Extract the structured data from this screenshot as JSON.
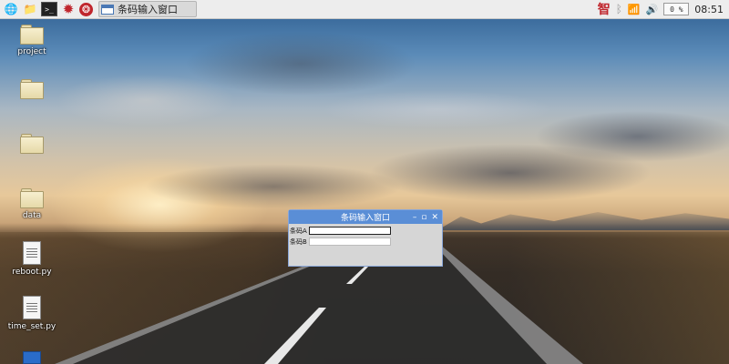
{
  "taskbar": {
    "launchers": [
      {
        "name": "globe-icon",
        "glyph": "🌐"
      },
      {
        "name": "folder-icon",
        "glyph": "📁"
      },
      {
        "name": "terminal-icon",
        "glyph": ">_"
      },
      {
        "name": "star-burst-icon",
        "glyph": "✹"
      },
      {
        "name": "wolfram-icon",
        "glyph": "❂"
      }
    ],
    "task": {
      "label": "条码输入窗口"
    },
    "tray": {
      "ime": "智",
      "bluetooth_glyph": "ᛒ",
      "wifi_glyph": "📶",
      "volume_glyph": "🔊",
      "cpu": "0 %",
      "clock": "08:51"
    }
  },
  "desktop": {
    "icons": [
      {
        "label": "project",
        "kind": "folder"
      },
      {
        "label": "",
        "kind": "folder"
      },
      {
        "label": "",
        "kind": "folder"
      },
      {
        "label": "data",
        "kind": "folder"
      },
      {
        "label": "reboot.py",
        "kind": "file"
      },
      {
        "label": "time_set.py",
        "kind": "file"
      }
    ]
  },
  "dialog": {
    "title": "条码输入窗口",
    "controls": {
      "minimize": "–",
      "maximize": "▫",
      "close": "✕"
    },
    "fields": [
      {
        "label": "条码A",
        "value": ""
      },
      {
        "label": "条码B",
        "value": ""
      }
    ]
  },
  "colors": {
    "taskbar_bg": "#ededed",
    "dialog_title_bg": "#5a8ed6",
    "dialog_bg": "#d6d6d6"
  }
}
